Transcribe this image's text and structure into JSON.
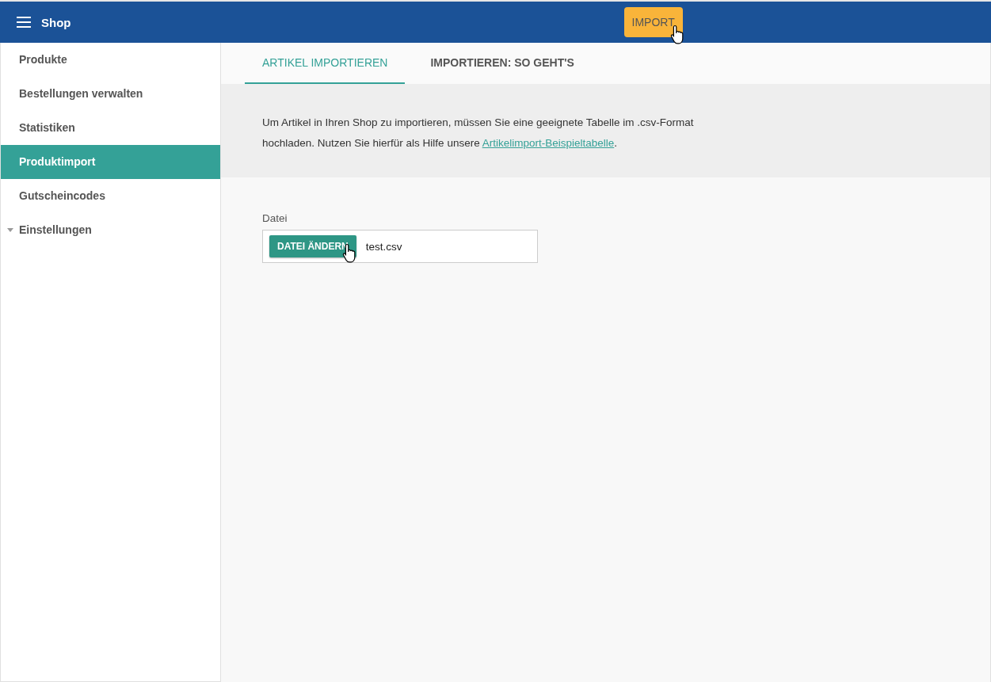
{
  "app_bar": {
    "title": "Shop",
    "action": "IMPORT"
  },
  "sidebar": {
    "items": [
      {
        "label": "Produkte",
        "kind": "link",
        "selected": false
      },
      {
        "label": "Bestellungen verwalten",
        "kind": "link",
        "selected": false
      },
      {
        "label": "Statistiken",
        "kind": "link",
        "selected": false
      },
      {
        "label": "Produktimport",
        "kind": "link",
        "selected": true
      },
      {
        "label": "Gutscheincodes",
        "kind": "link",
        "selected": false
      },
      {
        "label": "Einstellungen",
        "kind": "group",
        "selected": false
      }
    ]
  },
  "tabs": [
    {
      "label": "ARTIKEL IMPORTIEREN",
      "selected": true
    },
    {
      "label": "IMPORTIEREN: SO GEHT'S",
      "selected": false
    }
  ],
  "info": {
    "text_before": "Um Artikel in Ihren Shop zu importieren, müssen Sie eine geeignete Tabelle im .csv-Format hochladen. Nutzen Sie hierfür als Hilfe unsere ",
    "link": "Artikelimport-Beispieltabelle",
    "text_after": "."
  },
  "file_field": {
    "label": "Datei",
    "button": "DATEI ÄNDERN",
    "value": "test.csv"
  }
}
